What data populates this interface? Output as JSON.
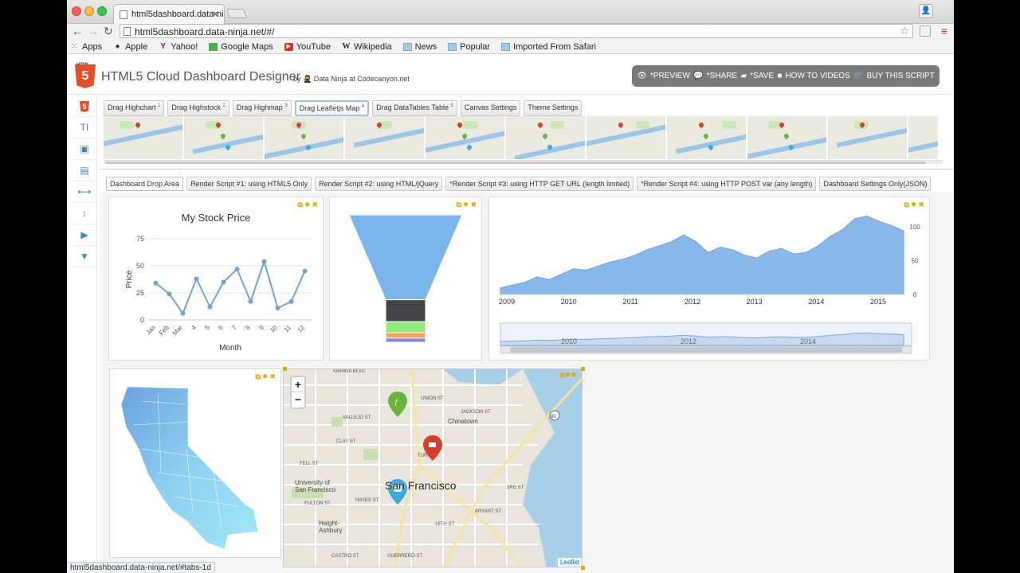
{
  "browser": {
    "tab_title": "html5dashboard.data-ninja",
    "url": "html5dashboard.data-ninja.net/#/",
    "status_url": "html5dashboard.data-ninja.net/#tabs-1d",
    "bookmarks": [
      "Apps",
      "Apple",
      "Yahoo!",
      "Google Maps",
      "YouTube",
      "Wikipedia",
      "News",
      "Popular",
      "Imported From Safari"
    ]
  },
  "app": {
    "logo_text": "HTML",
    "logo_glyph": "5",
    "title": "HTML5 Cloud Dashboard Designer",
    "byline_by": "by",
    "byline": "Data Ninja at Codecanyon.net",
    "actions": [
      "*PREVIEW",
      "*SHARE",
      "*SAVE",
      "HOW TO VIDEOS",
      "BUY THIS SCRIPT"
    ]
  },
  "sidebar": {
    "icons": [
      "html5-icon",
      "text-icon",
      "image-icon",
      "document-icon",
      "horizontal-spacer-icon",
      "vertical-spacer-icon",
      "video-icon",
      "dropdown-icon"
    ],
    "glyph_text": "TI"
  },
  "components": {
    "buttons": [
      {
        "label": "Drag Highchart",
        "sup": "1"
      },
      {
        "label": "Drag Highstock",
        "sup": "2"
      },
      {
        "label": "Drag Highmap",
        "sup": "3"
      },
      {
        "label": "Drag Leafletjs Map",
        "sup": "4"
      },
      {
        "label": "Drag DataTables Table",
        "sup": "5"
      },
      {
        "label": "Canvas Settings",
        "sup": ""
      },
      {
        "label": "Theme Settings",
        "sup": ""
      }
    ],
    "active_index": 3
  },
  "render_tabs": [
    "Dashboard Drop Area",
    "Render Script #1: using HTML5 Only",
    "Render Script #2: using HTML/jQuery",
    "*Render Script #3: using HTTP GET URL (length limited)",
    "*Render Script #4: using HTTP POST var (any length)",
    "Dashboard Settings Only(JSON)"
  ],
  "chart_data": [
    {
      "type": "line",
      "title": "My Stock Price",
      "xlabel": "Month",
      "ylabel": "Price",
      "categories": [
        "Jan",
        "Feb",
        "Mar",
        "4",
        "5",
        "6",
        "7",
        "8",
        "9",
        "10",
        "11",
        "12"
      ],
      "values": [
        34,
        24,
        6,
        38,
        12,
        35,
        47,
        17,
        54,
        11,
        17,
        45
      ],
      "ylim": [
        0,
        75
      ],
      "yticks": [
        0,
        25,
        50,
        75
      ],
      "color": "#6aa6dc"
    },
    {
      "type": "funnel",
      "stages": [
        {
          "value": 62,
          "color": "#7cb5ec"
        },
        {
          "value": 16,
          "color": "#434348"
        },
        {
          "value": 8,
          "color": "#90ed7d"
        },
        {
          "value": 4,
          "color": "#f7a35c"
        },
        {
          "value": 3,
          "color": "#8085e9"
        }
      ]
    },
    {
      "type": "area",
      "x_ticks": [
        "2009",
        "2010",
        "2011",
        "2012",
        "2013",
        "2014",
        "2015"
      ],
      "yticks": [
        0,
        50,
        100
      ],
      "values": [
        10,
        14,
        18,
        26,
        22,
        30,
        38,
        36,
        42,
        48,
        52,
        58,
        66,
        72,
        78,
        88,
        78,
        62,
        70,
        66,
        58,
        54,
        64,
        68,
        60,
        62,
        72,
        86,
        96,
        112,
        116,
        108,
        102,
        94
      ],
      "navigator_ticks": [
        "2010",
        "2012",
        "2014"
      ],
      "color": "#88b8ea"
    }
  ],
  "map": {
    "city": "San Francisco",
    "zoom_in": "+",
    "zoom_out": "−",
    "attribution": "Leaflet",
    "streets": [
      "MARINA BLVD",
      "UNION ST",
      "VALLEJO ST",
      "JACKSON ST",
      "CLAY ST",
      "FELL ST",
      "FULTON ST",
      "TURK ST",
      "Chinatown",
      "University of San Francisco",
      "Haight-Ashbury",
      "HAYES ST",
      "3RD ST",
      "BRYANT ST",
      "16TH ST",
      "GUERRERO ST",
      "CASTRO ST",
      "80"
    ],
    "markers": [
      {
        "name": "food",
        "color": "#6ab43c"
      },
      {
        "name": "coffee",
        "color": "#d63e2a"
      },
      {
        "name": "bus",
        "color": "#38aadd"
      }
    ]
  }
}
